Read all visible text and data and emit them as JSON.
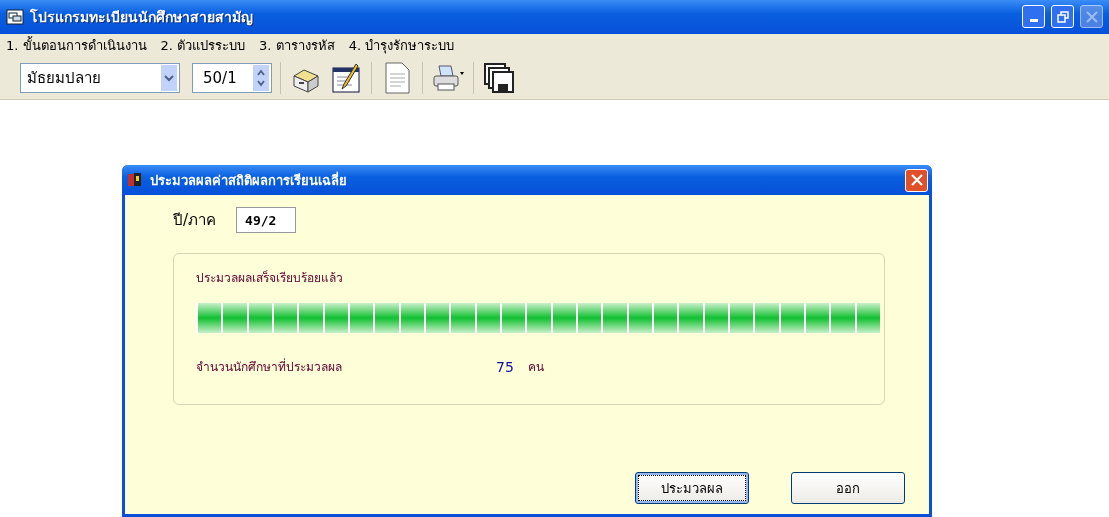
{
  "window": {
    "title": "โปรแกรมทะเบียนนักศึกษาสายสามัญ"
  },
  "menu": [
    "1. ขั้นตอนการดำเนินงาน",
    "2. ตัวแปรระบบ",
    "3. ตารางรหัส",
    "4. บำรุงรักษาระบบ"
  ],
  "toolbar": {
    "level_select": {
      "value": "มัธยมปลาย"
    },
    "term_spinner": {
      "value": "50/1"
    }
  },
  "dialog": {
    "title": "ประมวลผลค่าสถิติผลการเรียนเฉลี่ย",
    "term_label": "ปี/ภาค",
    "term_value": "49/2",
    "status": "ประมวลผลเสร็จเรียบร้อยแล้ว",
    "progress": {
      "level": 1
    },
    "count_label": "จำนวนนักศึกษาที่ประมวลผล",
    "count_value": "75",
    "count_unit": "คน",
    "buttons": [
      {
        "label": "ประมวลผล",
        "focused": true
      },
      {
        "label": "ออก",
        "focused": false
      }
    ]
  }
}
